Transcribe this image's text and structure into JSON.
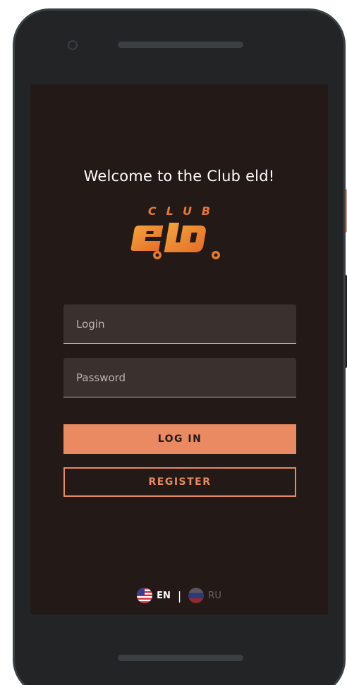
{
  "welcome_title": "Welcome to the Club eld!",
  "logo": {
    "top_text": "CLUB",
    "main_text": "eld",
    "colors": [
      "#e8792f",
      "#f3a23c"
    ]
  },
  "form": {
    "login_placeholder": "Login",
    "login_value": "",
    "password_placeholder": "Password",
    "password_value": ""
  },
  "buttons": {
    "login_label": "LOG IN",
    "register_label": "REGISTER"
  },
  "languages": {
    "items": [
      {
        "code": "EN",
        "icon": "us-flag-icon",
        "active": true
      },
      {
        "code": "RU",
        "icon": "ru-flag-icon",
        "active": false
      }
    ],
    "separator": "|"
  },
  "colors": {
    "accent": "#e98a62",
    "screen_background": "#231a18",
    "field_background": "#3a302d",
    "phone_frame": "#222426"
  }
}
